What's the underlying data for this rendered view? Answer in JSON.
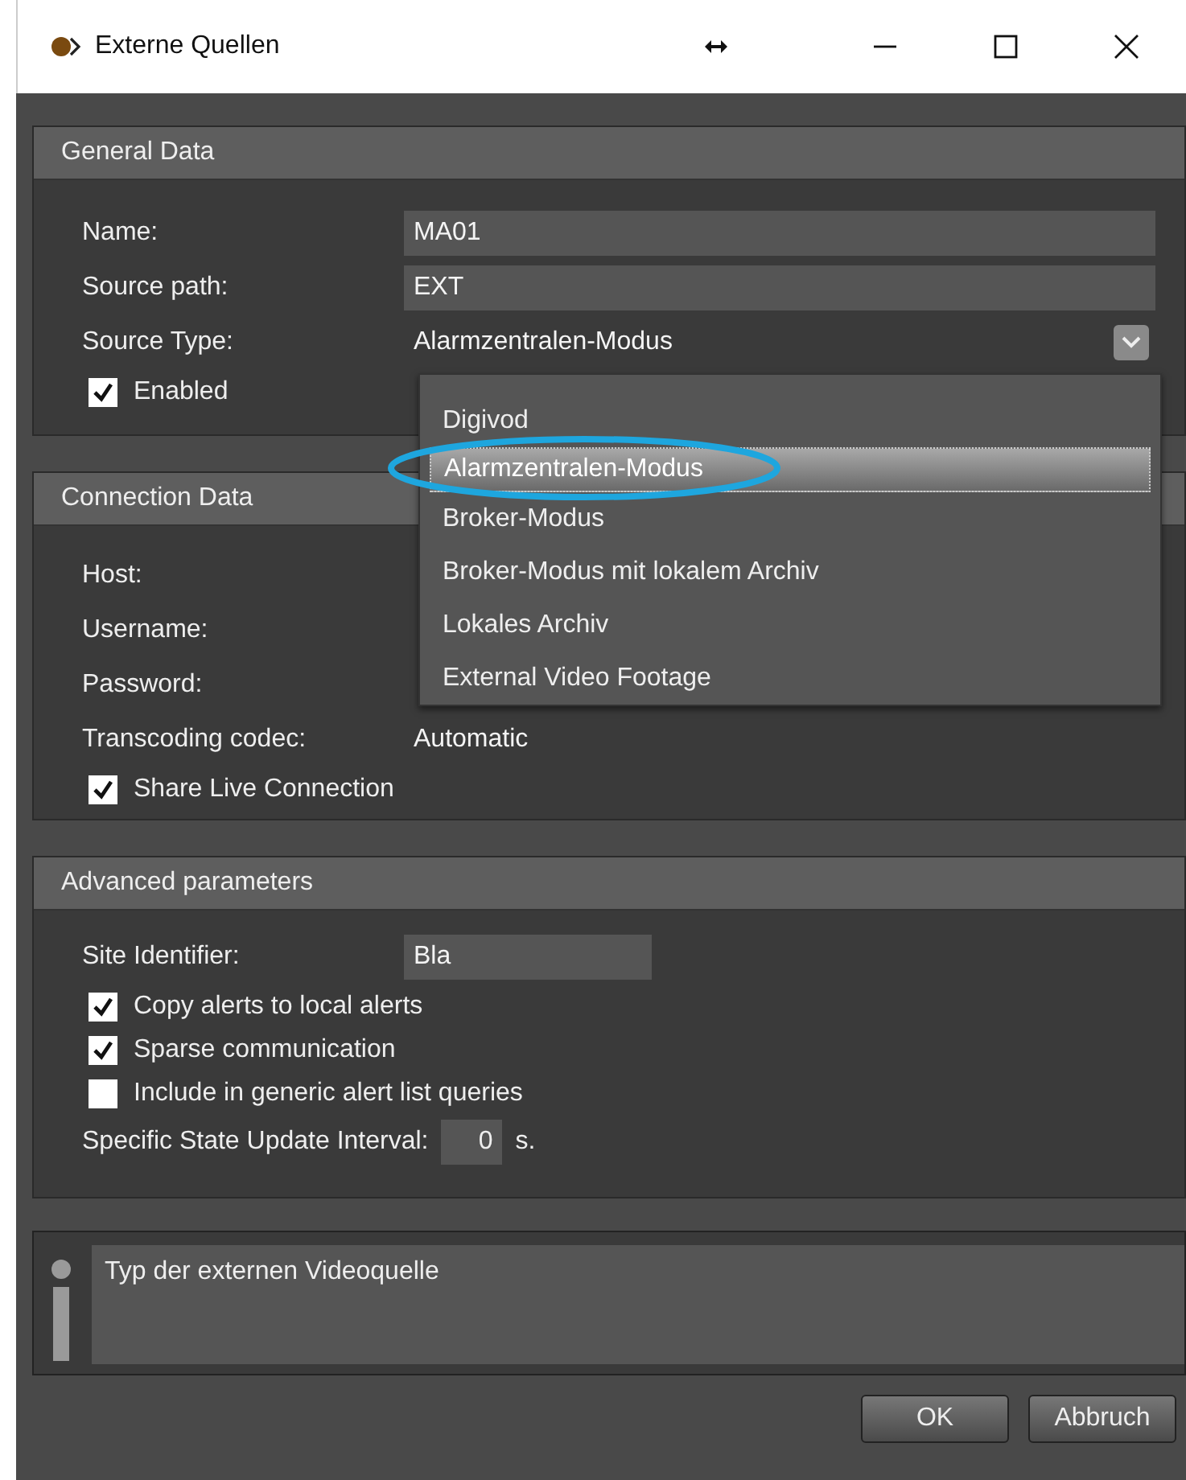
{
  "window": {
    "title": "Externe Quellen"
  },
  "general": {
    "title": "General Data",
    "fields": [
      {
        "label": "Name:",
        "value": "MA01",
        "kind": "text"
      },
      {
        "label": "Source path:",
        "value": "EXT",
        "kind": "text"
      },
      {
        "label": "Source Type:",
        "value": "Alarmzentralen-Modus",
        "kind": "select"
      }
    ],
    "enabled": {
      "label": "Enabled",
      "checked": true
    }
  },
  "dropdown": {
    "options": [
      {
        "label": "Digivod",
        "selected": false
      },
      {
        "label": "Alarmzentralen-Modus",
        "selected": true
      },
      {
        "label": "Broker-Modus",
        "selected": false
      },
      {
        "label": "Broker-Modus mit lokalem Archiv",
        "selected": false
      },
      {
        "label": "Lokales Archiv",
        "selected": false
      },
      {
        "label": "External Video Footage",
        "selected": false
      }
    ]
  },
  "connection": {
    "title": "Connection Data",
    "fields": [
      {
        "label": "Host:"
      },
      {
        "label": "Username:"
      },
      {
        "label": "Password:"
      }
    ],
    "transcoding": {
      "label": "Transcoding codec:",
      "value": "Automatic"
    },
    "share_live": {
      "label": "Share Live Connection",
      "checked": true
    }
  },
  "advanced": {
    "title": "Advanced parameters",
    "site_identifier": {
      "label": "Site Identifier:",
      "value": "Bla"
    },
    "options": [
      {
        "label": "Copy alerts to local alerts",
        "checked": true
      },
      {
        "label": "Sparse communication",
        "checked": true
      },
      {
        "label": "Include in generic alert list queries",
        "checked": false
      }
    ],
    "interval": {
      "label": "Specific State Update Interval:",
      "value": "0",
      "unit": "s."
    }
  },
  "info": {
    "text": "Typ der externen Videoquelle"
  },
  "buttons": [
    "OK",
    "Abbruch"
  ]
}
